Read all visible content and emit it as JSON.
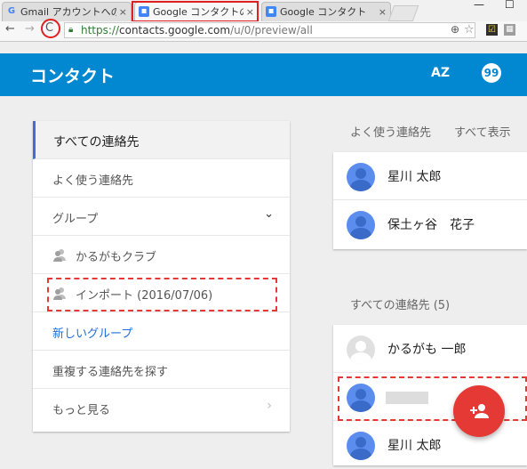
{
  "browser": {
    "tabs": [
      {
        "label": "Gmail アカウントへの追",
        "favicon": "google-g-icon",
        "close": "×",
        "active": false
      },
      {
        "label": "Google コンタクトのプレ",
        "favicon": "contacts-favicon",
        "close": "×",
        "active": true
      },
      {
        "label": "Google コンタクト",
        "favicon": "contacts-favicon",
        "close": "×",
        "active": false
      }
    ],
    "window_controls": {
      "minimize": "—",
      "maximize": "☐"
    },
    "back": "←",
    "forward": "→",
    "reload": "C",
    "url": {
      "scheme": "https://",
      "host": "contacts.google.com",
      "path": "/u/0/preview/all"
    }
  },
  "app": {
    "title": "コンタクト",
    "sort_icon_text": "AZ",
    "chat_icon_text": "99"
  },
  "sidebar": {
    "items": [
      {
        "label": "すべての連絡先",
        "selected": true
      },
      {
        "label": "よく使う連絡先"
      },
      {
        "label": "グループ",
        "expandable": true
      },
      {
        "label": "かるがもクラブ",
        "icon": "group-icon"
      },
      {
        "label": "インポート (2016/07/06)",
        "icon": "group-icon"
      },
      {
        "label": "新しいグループ",
        "link": true
      },
      {
        "label": "重複する連絡先を探す"
      },
      {
        "label": "もっと見る",
        "has_arrow": true
      }
    ]
  },
  "frequent": {
    "heading": "よく使う連絡先",
    "show_all": "すべて表示",
    "contacts": [
      {
        "name": "星川 太郎"
      },
      {
        "name": "保土ヶ谷　花子"
      }
    ]
  },
  "all": {
    "heading": "すべての連絡先 (5)",
    "contacts": [
      {
        "name": "かるがも 一郎",
        "avatar": "grey"
      },
      {
        "name": "",
        "avatar": "blue",
        "blurred": true
      },
      {
        "name": "星川 太郎",
        "avatar": "blue"
      }
    ]
  },
  "fab": {
    "icon": "add-person-icon"
  },
  "colors": {
    "appbar": "#0288d1",
    "fab": "#e53935",
    "link": "#1e6fd9",
    "highlight": "#e53935"
  }
}
